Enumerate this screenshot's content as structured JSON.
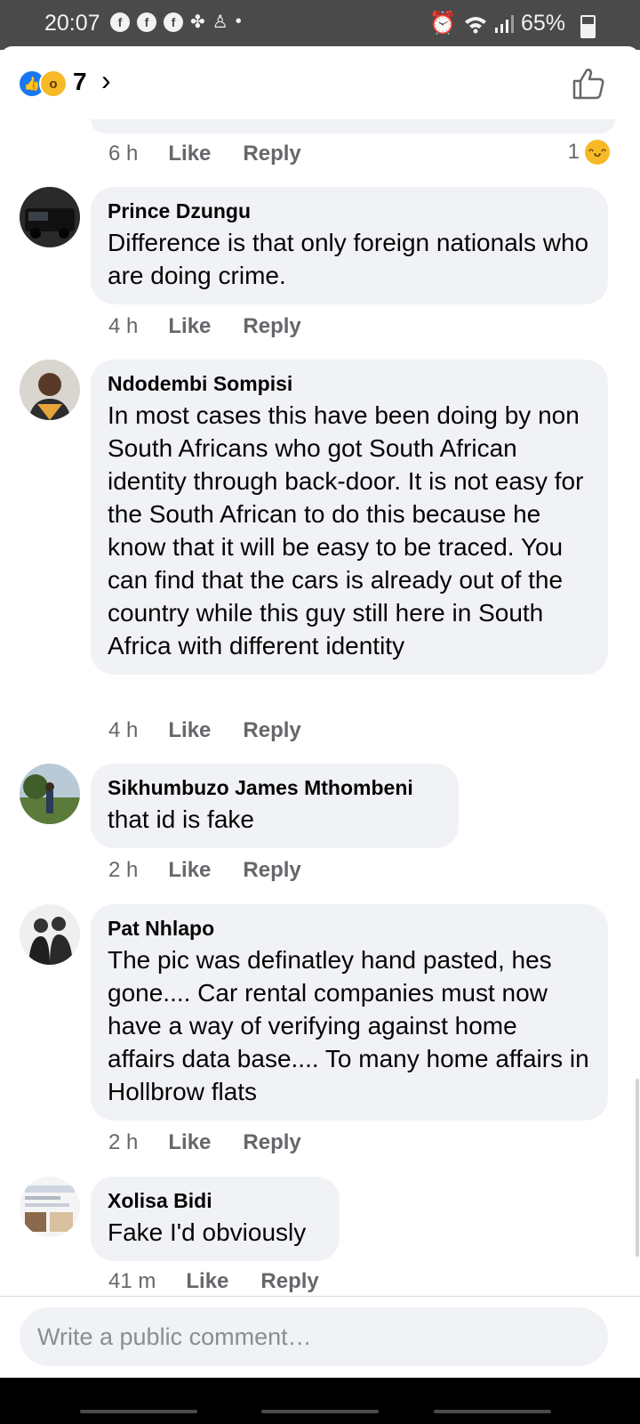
{
  "status_bar": {
    "time": "20:07",
    "battery": "65%",
    "notification_icons": [
      "facebook-icon",
      "facebook-icon",
      "facebook-icon",
      "app-icon",
      "app-icon"
    ],
    "dot": "•"
  },
  "header": {
    "reaction_count": "7",
    "chevron": "›"
  },
  "previous_comment": {
    "time": "6 h",
    "like_label": "Like",
    "reply_label": "Reply",
    "reaction_count": "1"
  },
  "comments": [
    {
      "author": "Prince Dzungu",
      "text": "Difference is that only foreign nationals who are doing crime.",
      "time": "4 h",
      "like_label": "Like",
      "reply_label": "Reply"
    },
    {
      "author": "Ndodembi Sompisi",
      "text": "In most cases this have been doing by non South Africans who got South African identity through back-door. It is not easy for the South African to do this because he know that it will be easy to be traced. You can find that the cars is already out of the country while this guy still here in South Africa with different identity",
      "time": "4 h",
      "like_label": "Like",
      "reply_label": "Reply"
    },
    {
      "author": "Sikhumbuzo James Mthombeni",
      "text": "that id is fake",
      "time": "2 h",
      "like_label": "Like",
      "reply_label": "Reply"
    },
    {
      "author": "Pat Nhlapo",
      "text": "The pic was definatley hand pasted, hes gone.... Car rental companies must now have a way of verifying against home affairs data base.... To many home affairs in Hollbrow flats",
      "time": "2 h",
      "like_label": "Like",
      "reply_label": "Reply"
    },
    {
      "author": "Xolisa Bidi",
      "text": "Fake I'd obviously",
      "time": "41 m",
      "like_label": "Like",
      "reply_label": "Reply"
    }
  ],
  "composer": {
    "placeholder": "Write a public comment…"
  }
}
